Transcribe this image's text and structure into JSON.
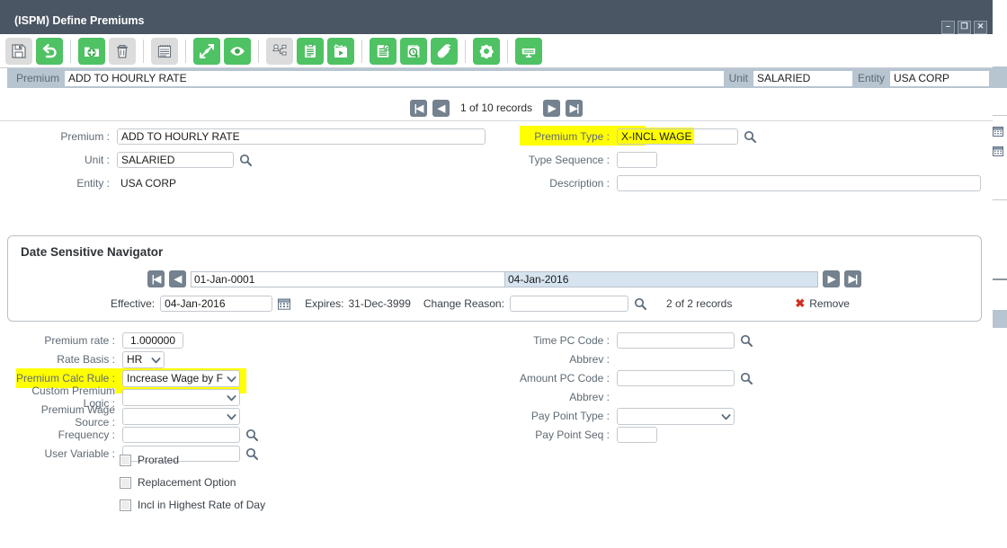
{
  "window": {
    "title": "(ISPM) Define Premiums",
    "controls": [
      {
        "name": "minimize",
        "glyph": "–"
      },
      {
        "name": "maximize",
        "glyph": "❐"
      },
      {
        "name": "close",
        "glyph": "✕"
      }
    ]
  },
  "toolbar": {
    "buttons": [
      {
        "name": "save-icon",
        "style": "grey",
        "title": "Save"
      },
      {
        "name": "undo-icon",
        "style": "green",
        "title": "Undo"
      },
      {
        "name": "add-icon",
        "style": "green",
        "title": "Add"
      },
      {
        "name": "delete-icon",
        "style": "grey",
        "title": "Delete"
      },
      {
        "name": "list-icon",
        "style": "grey",
        "title": "List"
      },
      {
        "name": "expand-icon",
        "style": "green",
        "title": "Expand"
      },
      {
        "name": "view-icon",
        "style": "green",
        "title": "View"
      },
      {
        "name": "org-chart-icon",
        "style": "grey",
        "title": "Org Chart"
      },
      {
        "name": "clipboard-icon",
        "style": "green",
        "title": "Clipboard"
      },
      {
        "name": "schedule-icon",
        "style": "green",
        "title": "Schedule"
      },
      {
        "name": "report-check-icon",
        "style": "green",
        "title": "Report"
      },
      {
        "name": "history-icon",
        "style": "green",
        "title": "History"
      },
      {
        "name": "attach-icon",
        "style": "green",
        "title": "Attach"
      },
      {
        "name": "settings-icon",
        "style": "green",
        "title": "Settings"
      },
      {
        "name": "display-icon",
        "style": "green",
        "title": "Display"
      }
    ]
  },
  "strip": {
    "premium_label": "Premium",
    "premium_value": "ADD TO HOURLY RATE",
    "unit_label": "Unit",
    "unit_value": "SALARIED",
    "entity_label": "Entity",
    "entity_value": "USA CORP"
  },
  "record_nav": {
    "first": "|◀",
    "prev": "◀",
    "count": "1 of 10 records",
    "next": "▶",
    "last": "▶|"
  },
  "form_top": {
    "premium_label": "Premium :",
    "premium_value": "ADD TO HOURLY RATE",
    "unit_label": "Unit :",
    "unit_value": "SALARIED",
    "entity_label": "Entity :",
    "entity_value": "USA CORP",
    "premium_type_label": "Premium Type :",
    "premium_type_value": "X-INCL WAGE",
    "type_sequence_label": "Type Sequence :",
    "type_sequence_value": "",
    "description_label": "Description :",
    "description_value": ""
  },
  "dsn": {
    "title": "Date Sensitive Navigator",
    "first": "|◀",
    "prev": "◀",
    "next": "▶",
    "last": "▶|",
    "range_start": "01-Jan-0001",
    "range_end": "04-Jan-2016",
    "effective_label": "Effective:",
    "effective_value": "04-Jan-2016",
    "expires_label": "Expires:",
    "expires_value": "31-Dec-3999",
    "change_reason_label": "Change Reason:",
    "change_reason_value": "",
    "records": "2 of 2 records",
    "remove_label": "Remove",
    "remove_glyph": "✖"
  },
  "form_bottom_left": {
    "premium_rate_label": "Premium rate :",
    "premium_rate_value": "1.000000",
    "rate_basis_label": "Rate Basis :",
    "rate_basis_value": "HR",
    "premium_calc_rule_label": "Premium Calc Rule :",
    "premium_calc_rule_value": "Increase Wage by Fl...",
    "custom_premium_logic_label": "Custom Premium Logic :",
    "custom_premium_logic_value": "",
    "premium_wage_source_label": "Premium Wage Source :",
    "premium_wage_source_value": "",
    "frequency_label": "Frequency :",
    "frequency_value": "",
    "user_variable_label": "User Variable :",
    "user_variable_value": "",
    "checkboxes": [
      {
        "label": "Prorated",
        "checked": false
      },
      {
        "label": "Replacement Option",
        "checked": false
      },
      {
        "label": "Incl in Highest Rate of Day",
        "checked": false
      }
    ]
  },
  "form_bottom_right": {
    "time_pc_code_label": "Time PC Code :",
    "time_pc_code_value": "",
    "abbrev1_label": "Abbrev :",
    "abbrev1_value": "",
    "amount_pc_code_label": "Amount PC Code :",
    "amount_pc_code_value": "",
    "abbrev2_label": "Abbrev :",
    "abbrev2_value": "",
    "pay_point_type_label": "Pay Point Type :",
    "pay_point_type_value": "",
    "pay_point_seq_label": "Pay Point Seq :",
    "pay_point_seq_value": ""
  },
  "colors": {
    "titlebar": "#4a5663",
    "strip": "#b7c5d1",
    "accent_green": "#4fc264",
    "nav_button": "#74818f",
    "highlight": "#ffff00",
    "remove_red": "#d03020",
    "selected_field": "#d6e4f0"
  }
}
